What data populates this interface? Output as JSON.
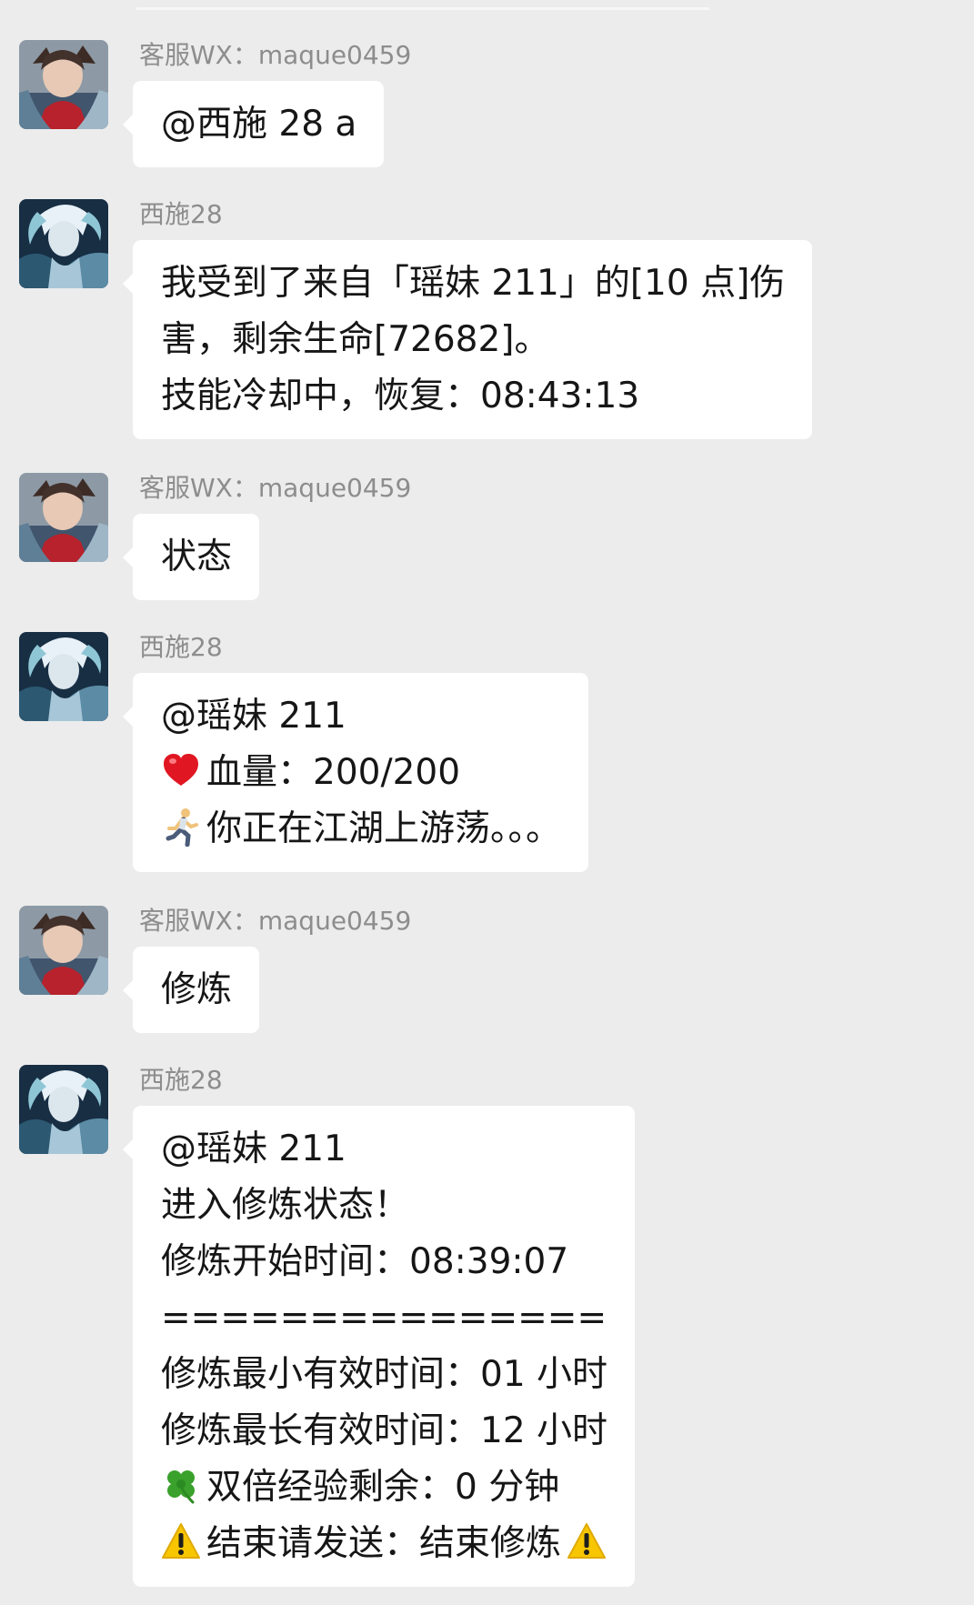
{
  "theme": {
    "background": "#ececec",
    "bubble": "#ffffff",
    "sender_color": "#8d8d8d",
    "text_color": "#161616"
  },
  "messages": [
    {
      "sender": "客服WX：maque0459",
      "avatar": "avatar-staff",
      "lines": [
        "@西施 28 a"
      ]
    },
    {
      "sender": "西施28",
      "avatar": "avatar-xishi",
      "lines": [
        "我受到了来自「瑶妹 211」的[10 点]伤",
        "害，剩余生命[72682]。",
        "技能冷却中，恢复：08:43:13"
      ]
    },
    {
      "sender": "客服WX：maque0459",
      "avatar": "avatar-staff",
      "lines": [
        "状态"
      ]
    },
    {
      "sender": "西施28",
      "avatar": "avatar-xishi",
      "lines": [
        "@瑶妹 211",
        "血量：200/200",
        "你正在江湖上游荡。。。"
      ],
      "line_icons": [
        "",
        "heart-emoji-icon",
        "runner-emoji-icon"
      ]
    },
    {
      "sender": "客服WX：maque0459",
      "avatar": "avatar-staff",
      "lines": [
        "修炼"
      ]
    },
    {
      "sender": "西施28",
      "avatar": "avatar-xishi",
      "lines": [
        "@瑶妹 211",
        "进入修炼状态！",
        "修炼开始时间：08:39:07",
        "===============",
        "修炼最小有效时间：01 小时",
        "修炼最长有效时间：12 小时",
        "双倍经验剩余：0 分钟",
        "结束请发送：结束修炼"
      ],
      "line_icons": [
        "",
        "",
        "",
        "",
        "",
        "",
        "clover-emoji-icon",
        "warning-emoji-icon"
      ],
      "trailing_icon": "warning-emoji-icon"
    }
  ]
}
